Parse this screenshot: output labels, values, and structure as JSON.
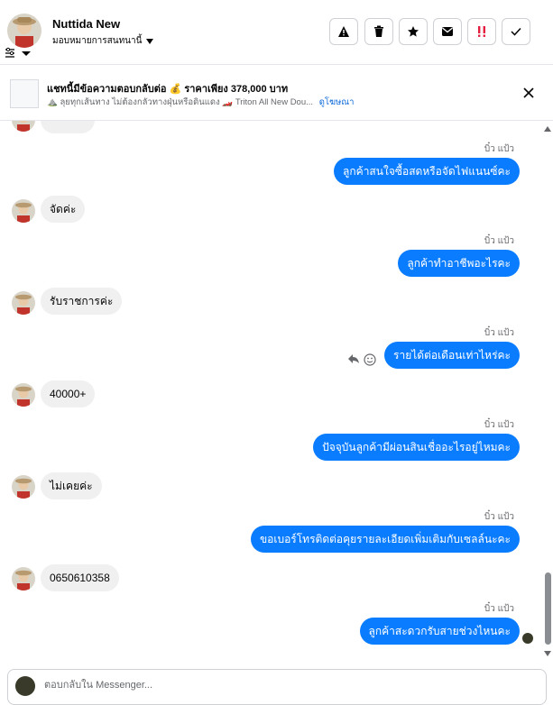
{
  "header": {
    "name": "Nuttida New",
    "assigned_label": "มอบหมายการสนทนานี้",
    "actions": [
      {
        "name": "alert-icon",
        "glyph": "⚠"
      },
      {
        "name": "trash-icon",
        "glyph": "🗑"
      },
      {
        "name": "star-icon",
        "glyph": "★"
      },
      {
        "name": "mail-icon",
        "glyph": "✉"
      },
      {
        "name": "spam-icon",
        "glyph": "‼"
      },
      {
        "name": "check-icon",
        "glyph": "✓"
      }
    ]
  },
  "ad": {
    "title": "แชทนี้มีข้อความตอบกลับต่อ 💰 ราคาเพียง 378,000 บาท",
    "subtitle": "⛰️ ลุยทุกเส้นทาง ไม่ต้องกลัวทางฝุ่นหรือดินแดง 🏎️ Triton All New Dou...",
    "link": "ดูโฆษณา"
  },
  "messages": [
    {
      "dir": "out",
      "sender": "บิ๋ว แป้ว",
      "text": "ลูกค้าสนใจซื้อสดหรือจัดไฟแนนซ์คะ"
    },
    {
      "dir": "in",
      "text": "จัดค่ะ"
    },
    {
      "dir": "out",
      "sender": "บิ๋ว แป้ว",
      "text": "ลูกค้าทำอาชีพอะไรคะ"
    },
    {
      "dir": "in",
      "text": "รับราชการค่ะ"
    },
    {
      "dir": "out",
      "sender": "บิ๋ว แป้ว",
      "text": "รายได้ต่อเดือนเท่าไหร่คะ"
    },
    {
      "dir": "in",
      "text": "40000+"
    },
    {
      "dir": "out",
      "sender": "บิ๋ว แป้ว",
      "text": "ปัจจุบันลูกค้ามีผ่อนสินเชื่ออะไรอยู่ไหมคะ"
    },
    {
      "dir": "in",
      "text": "ไม่เคยค่ะ"
    },
    {
      "dir": "out",
      "sender": "บิ๋ว แป้ว",
      "text": "ขอเบอร์โทรติดต่อคุยรายละเอียดเพิ่มเติมกับเซลล์นะคะ"
    },
    {
      "dir": "in",
      "text": "0650610358"
    },
    {
      "dir": "out",
      "sender": "บิ๋ว แป้ว",
      "text": "ลูกค้าสะดวกรับสายช่วงไหนคะ"
    }
  ],
  "compose": {
    "placeholder": "ตอบกลับใน Messenger..."
  },
  "colors": {
    "outgoing": "#0a7cff",
    "incoming": "#f0f0f0"
  }
}
